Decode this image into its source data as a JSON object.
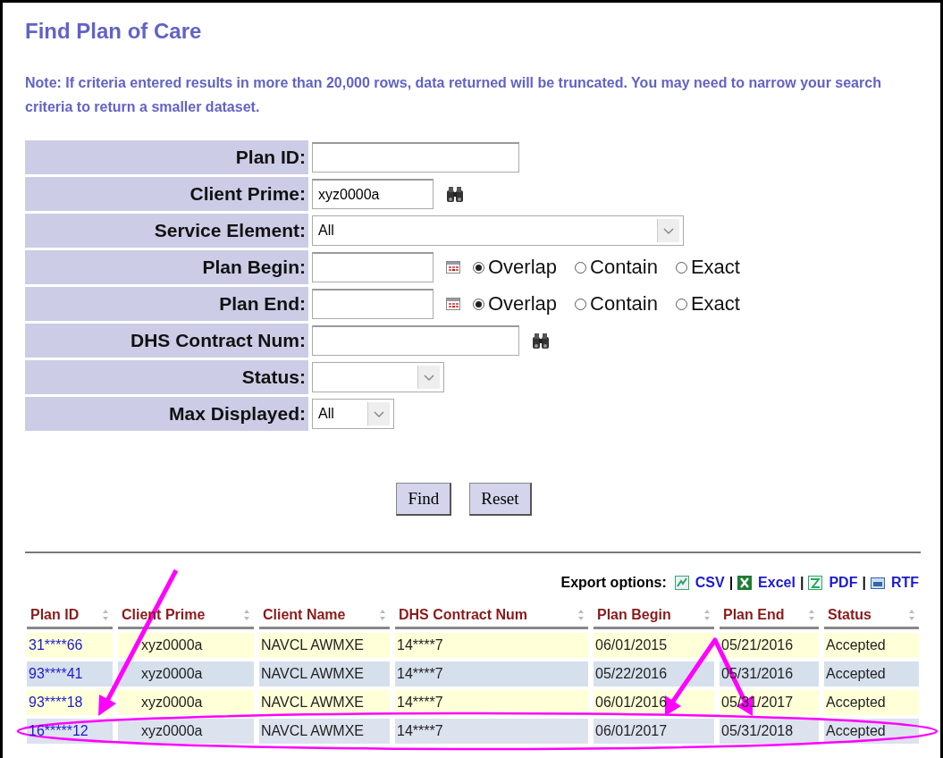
{
  "title": "Find Plan of Care",
  "note": "Note: If criteria entered results in more than 20,000 rows, data returned will be truncated. You may need to narrow your search criteria to return a smaller dataset.",
  "form": [
    {
      "kind": "text",
      "label": "Plan ID:"
    },
    {
      "kind": "lookup",
      "label": "Client Prime:",
      "value": "xyz0000a"
    },
    {
      "kind": "select",
      "label": "Service Element:",
      "value": "All"
    },
    {
      "kind": "date",
      "label": "Plan Begin:",
      "options": [
        {
          "label": "Overlap",
          "selected": true
        },
        {
          "label": "Contain",
          "selected": false
        },
        {
          "label": "Exact",
          "selected": false
        }
      ]
    },
    {
      "kind": "date",
      "label": "Plan End:",
      "options": [
        {
          "label": "Overlap",
          "selected": true
        },
        {
          "label": "Contain",
          "selected": false
        },
        {
          "label": "Exact",
          "selected": false
        }
      ]
    },
    {
      "kind": "lookup",
      "label": "DHS Contract Num:"
    },
    {
      "kind": "select",
      "label": "Status:"
    },
    {
      "kind": "select",
      "label": "Max Displayed:",
      "value": "All"
    }
  ],
  "buttons": [
    "Find",
    "Reset"
  ],
  "export": {
    "label": "Export options:",
    "separator": "|",
    "formats": [
      {
        "kind": "csv",
        "label": "CSV"
      },
      {
        "kind": "excel",
        "label": "Excel"
      },
      {
        "kind": "pdf",
        "label": "PDF"
      },
      {
        "kind": "rtf",
        "label": "RTF"
      }
    ]
  },
  "table": {
    "columns": [
      "Plan ID",
      "Client Prime",
      "Client Name",
      "DHS Contract Num",
      "Plan Begin",
      "Plan End",
      "Status"
    ],
    "rows": [
      {
        "highlighted": false,
        "cells": [
          "31****66",
          "xyz0000a",
          "NAVCL AWMXE",
          "14****7",
          "06/01/2015",
          "05/21/2016",
          "Accepted"
        ]
      },
      {
        "highlighted": false,
        "cells": [
          "93****41",
          "xyz0000a",
          "NAVCL AWMXE",
          "14****7",
          "05/22/2016",
          "05/31/2016",
          "Accepted"
        ]
      },
      {
        "highlighted": false,
        "cells": [
          "93****18",
          "xyz0000a",
          "NAVCL AWMXE",
          "14****7",
          "06/01/2016",
          "05/31/2017",
          "Accepted"
        ]
      },
      {
        "highlighted": true,
        "cells": [
          "16*****12",
          "xyz0000a",
          "NAVCL AWMXE",
          "14****7",
          "06/01/2017",
          "05/31/2018",
          "Accepted"
        ]
      }
    ]
  }
}
